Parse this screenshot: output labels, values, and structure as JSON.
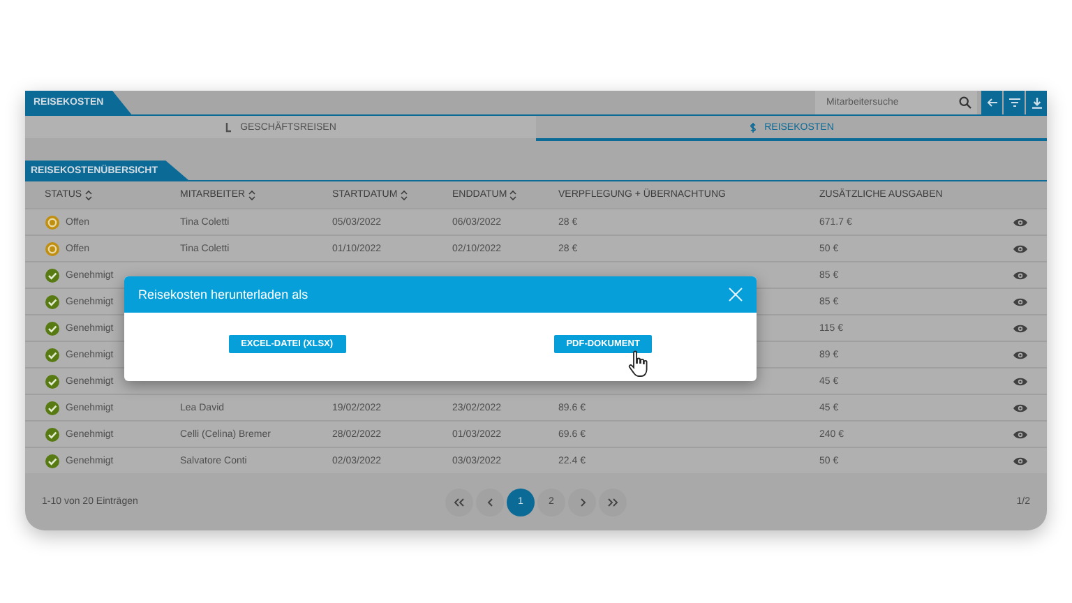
{
  "header": {
    "title": "REISEKOSTEN",
    "search": {
      "placeholder": "Mitarbeitersuche"
    }
  },
  "tabs": [
    {
      "label": "GESCHÄFTSREISEN",
      "selected": false
    },
    {
      "label": "REISEKOSTEN",
      "selected": true
    }
  ],
  "section": {
    "title": "REISEKOSTENÜBERSICHT"
  },
  "table": {
    "columns": [
      "STATUS",
      "MITARBEITER",
      "STARTDATUM",
      "ENDDATUM",
      "VERPFLEGUNG + ÜBERNACHTUNG",
      "ZUSÄTZLICHE AUSGABEN"
    ],
    "sortable": [
      true,
      true,
      true,
      true,
      false,
      false
    ],
    "rows": [
      {
        "kind": "open",
        "status": "Offen",
        "employee": "Tina Coletti",
        "start": "05/03/2022",
        "end": "06/03/2022",
        "meals": "28 €",
        "extra": "671.7 €"
      },
      {
        "kind": "open",
        "status": "Offen",
        "employee": "Tina Coletti",
        "start": "01/10/2022",
        "end": "02/10/2022",
        "meals": "28 €",
        "extra": "50 €"
      },
      {
        "kind": "approved",
        "status": "Genehmigt",
        "extra": "85 €"
      },
      {
        "kind": "approved",
        "status": "Genehmigt",
        "extra": "85 €"
      },
      {
        "kind": "approved",
        "status": "Genehmigt",
        "extra": "115 €"
      },
      {
        "kind": "approved",
        "status": "Genehmigt",
        "extra": "89 €"
      },
      {
        "kind": "approved",
        "status": "Genehmigt",
        "extra": "45 €"
      },
      {
        "kind": "approved",
        "status": "Genehmigt",
        "employee": "Lea David",
        "start": "19/02/2022",
        "end": "23/02/2022",
        "meals": "89.6 €",
        "extra": "45 €"
      },
      {
        "kind": "approved",
        "status": "Genehmigt",
        "employee": "Celli (Celina) Bremer",
        "start": "28/02/2022",
        "end": "01/03/2022",
        "meals": "69.6 €",
        "extra": "240 €"
      },
      {
        "kind": "approved",
        "status": "Genehmigt",
        "employee": "Salvatore Conti",
        "start": "02/03/2022",
        "end": "03/03/2022",
        "meals": "22.4 €",
        "extra": "50 €"
      }
    ]
  },
  "pagination": {
    "summary": "1-10 von 20 Einträgen",
    "pages": [
      {
        "label": "1",
        "selected": true
      },
      {
        "label": "2",
        "selected": false
      }
    ],
    "page_of": "1/2"
  },
  "modal": {
    "title": "Reisekosten herunterladen als",
    "buttons": [
      "EXCEL-DATEI (XLSX)",
      "PDF-DOKUMENT"
    ]
  }
}
